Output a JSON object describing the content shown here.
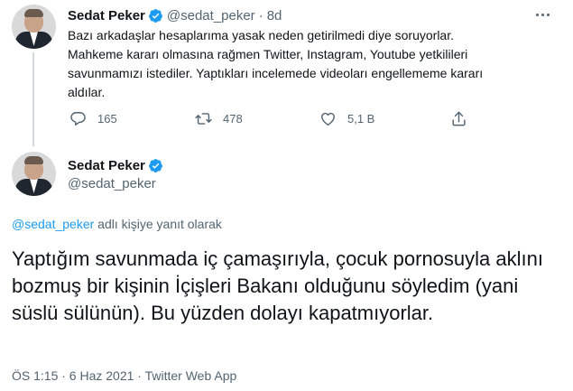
{
  "tweet": {
    "author": {
      "name": "Sedat Peker",
      "handle": "@sedat_peker",
      "time": "8d"
    },
    "text": "Bazı arkadaşlar hesaplarıma yasak neden getirilmedi diye soruyorlar. Mahkeme kararı olmasına rağmen Twitter, Instagram, Youtube yetkilileri savunmamızı istediler. Yaptıkları incelemede videoları engellememe kararı aldılar.",
    "actions": {
      "reply_count": "165",
      "retweet_count": "478",
      "like_count": "5,1 B"
    }
  },
  "reply": {
    "author": {
      "name": "Sedat Peker",
      "handle": "@sedat_peker"
    },
    "replying_mention": "@sedat_peker",
    "replying_suffix": " adlı kişiye yanıt olarak",
    "text": "Yaptığım savunmada iç çamaşırıyla, çocuk pornosuyla aklını bozmuş bir kişinin İçişleri Bakanı olduğunu söyledim (yani süslü sülünün). Bu yüzden dolayı kapatmıyorlar.",
    "meta": "ÖS 1:15 · 6 Haz 2021 · Twitter Web App"
  },
  "colors": {
    "accent": "#1d9bf0",
    "secondary_text": "#536471",
    "primary_text": "#0f1419",
    "divider": "#cfd9de"
  },
  "icons": {
    "verified": "verified-badge-icon",
    "more": "more-options-icon",
    "reply": "reply-icon",
    "retweet": "retweet-icon",
    "like": "like-icon",
    "share": "share-icon"
  }
}
